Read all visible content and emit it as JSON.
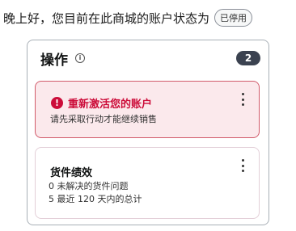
{
  "header": {
    "greeting": "晚上好，您目前在此商城的账户状态为",
    "status_badge": "已停用"
  },
  "actions_card": {
    "title": "操作",
    "info_icon": "info-icon",
    "count": "2",
    "alert": {
      "icon": "alert-icon",
      "title": "重新激活您的账户",
      "description": "请先采取行动才能继续销售"
    },
    "performance": {
      "title": "货件绩效",
      "line1_count": "0",
      "line1_text": "未解决的货件问题",
      "line2_count": "5",
      "line2_text": "最近 120 天内的总计"
    }
  },
  "colors": {
    "alert_red": "#cc0c39",
    "alert_bg": "#fbe9ec",
    "badge_dark": "#3b4250"
  }
}
